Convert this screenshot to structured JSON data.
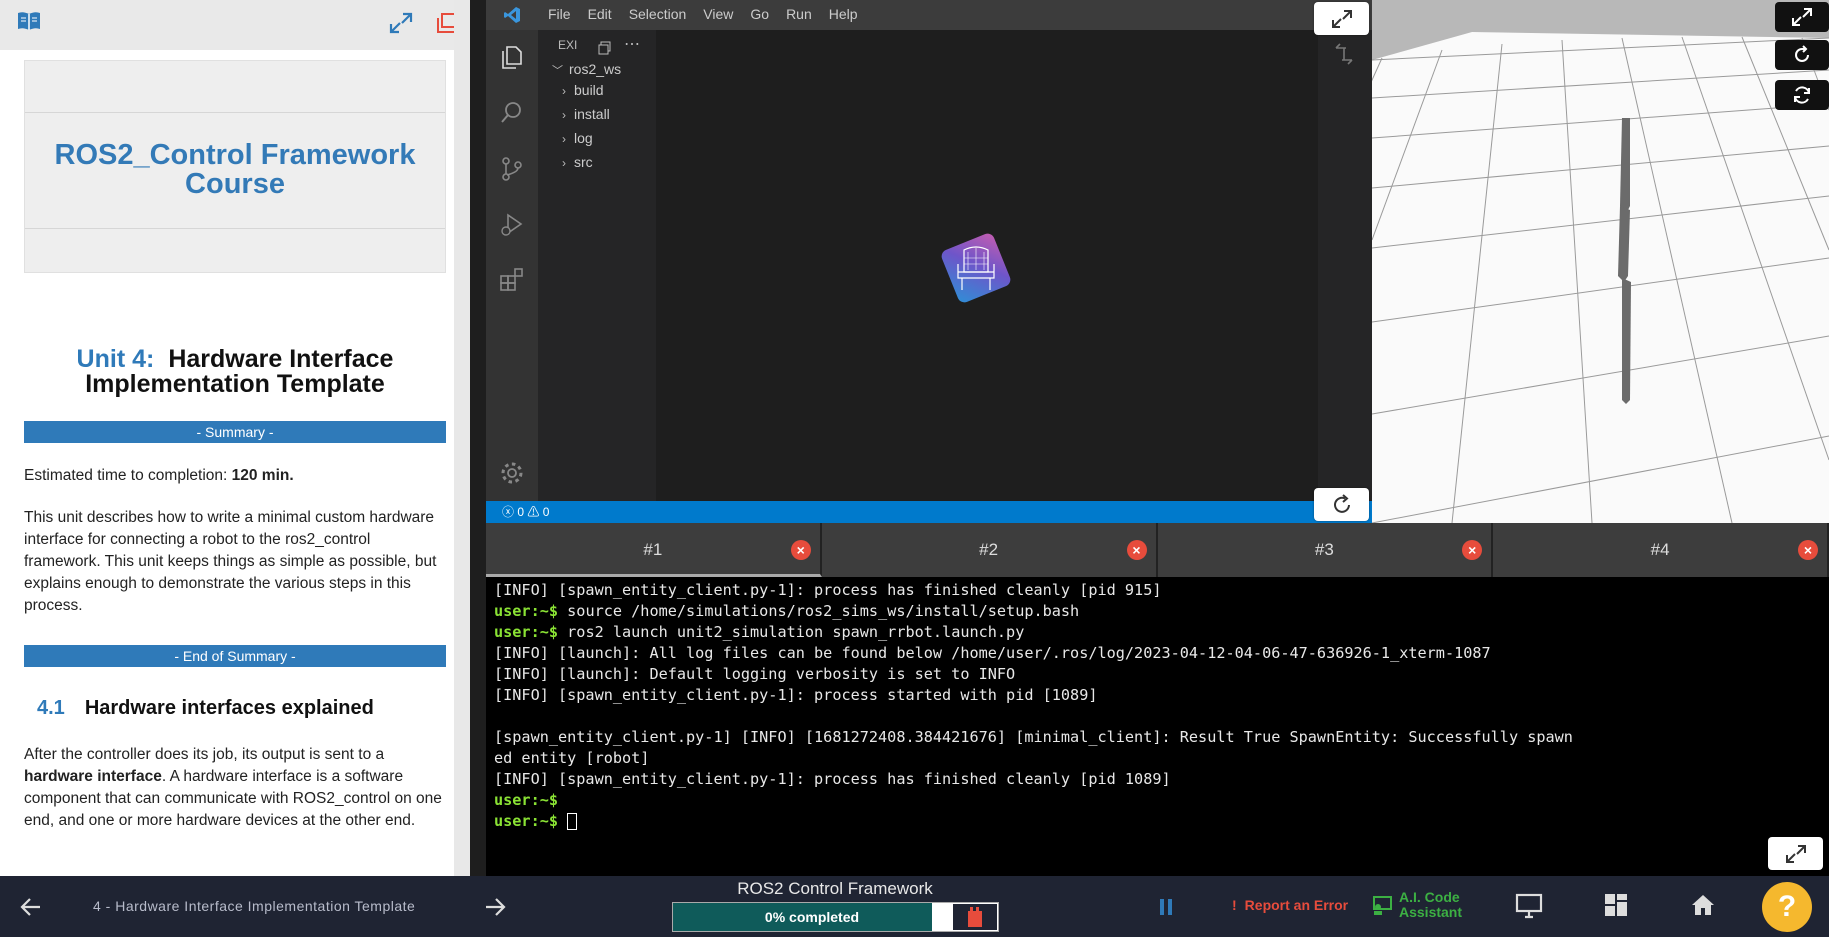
{
  "left_panel": {
    "course_title": "ROS2_Control Framework Course",
    "unit_number": "Unit 4:",
    "unit_title": "Hardware Interface Implementation Template",
    "summary_label": "- Summary -",
    "estimated_label": "Estimated time to completion:",
    "estimated_value": "120 min.",
    "description": "This unit describes how to write a minimal custom hardware interface for connecting a robot to the ros2_control framework. This unit keeps things as simple as possible, but explains enough to demonstrate the various steps in this process.",
    "end_summary_label": "- End of Summary -",
    "section_number": "4.1",
    "section_title": "Hardware interfaces explained",
    "section_para_before": "After the controller does its job, its output is sent to a",
    "section_para_bold": "hardware interface",
    "section_para_after": ". A hardware interface is a software component that can communicate with ROS2_control on one end, and one or more hardware devices at the other end."
  },
  "vscode": {
    "menu": [
      "File",
      "Edit",
      "Selection",
      "View",
      "Go",
      "Run",
      "Help"
    ],
    "explorer_header": "EXI",
    "tree": {
      "root": "ros2_ws",
      "children": [
        "build",
        "install",
        "log",
        "src"
      ]
    },
    "status": {
      "errors": "0",
      "warnings": "0"
    }
  },
  "terminal": {
    "tabs": [
      "#1",
      "#2",
      "#3",
      "#4"
    ],
    "active_tab": "#1",
    "lines": [
      {
        "prompt": "",
        "text": "[INFO] [spawn_entity_client.py-1]: process has finished cleanly [pid 915]"
      },
      {
        "prompt": "user:~$",
        "text": " source /home/simulations/ros2_sims_ws/install/setup.bash"
      },
      {
        "prompt": "user:~$",
        "text": " ros2 launch unit2_simulation spawn_rrbot.launch.py"
      },
      {
        "prompt": "",
        "text": "[INFO] [launch]: All log files can be found below /home/user/.ros/log/2023-04-12-04-06-47-636926-1_xterm-1087"
      },
      {
        "prompt": "",
        "text": "[INFO] [launch]: Default logging verbosity is set to INFO"
      },
      {
        "prompt": "",
        "text": "[INFO] [spawn_entity_client.py-1]: process started with pid [1089]"
      },
      {
        "prompt": "",
        "text": ""
      },
      {
        "prompt": "",
        "text": "[spawn_entity_client.py-1] [INFO] [1681272408.384421676] [minimal_client]: Result True SpawnEntity: Successfully spawn"
      },
      {
        "prompt": "",
        "text": "ed entity [robot]"
      },
      {
        "prompt": "",
        "text": "[INFO] [spawn_entity_client.py-1]: process has finished cleanly [pid 1089]"
      },
      {
        "prompt": "user:~$",
        "text": ""
      },
      {
        "prompt": "user:~$",
        "text": " "
      }
    ]
  },
  "bottom_bar": {
    "nav_title": "4 - Hardware Interface Implementation Template",
    "course_name": "ROS2 Control Framework",
    "progress_text": "0% completed",
    "progress_value": 0.92,
    "report_label": "Report an Error",
    "ai_label_line1": "A.I. Code",
    "ai_label_line2": "Assistant",
    "help_label": "?"
  },
  "colors": {
    "accent_blue": "#2f7ab9",
    "vscode_status": "#007acc",
    "terminal_user": "#8ae234",
    "report_red": "#e74c3c",
    "ai_green": "#3cb043",
    "help_yellow": "#f5b82e"
  }
}
